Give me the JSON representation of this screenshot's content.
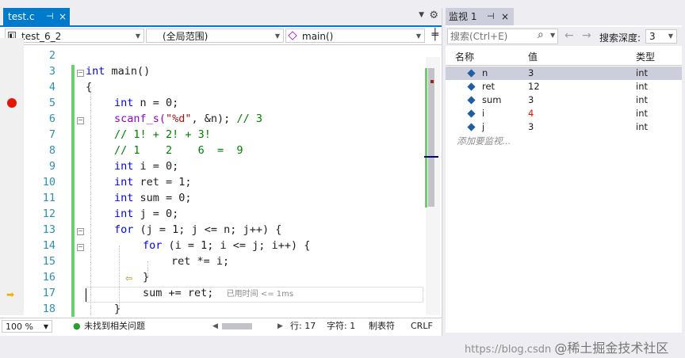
{
  "editor": {
    "tab_title": "test.c",
    "tab_pin": "⊣",
    "tab_close": "×",
    "tab_menu": "▼",
    "settings": "⚙",
    "nav": {
      "project": "test_6_2",
      "scope": "(全局范围)",
      "member": "main()"
    },
    "lines": [
      {
        "n": "2"
      },
      {
        "n": "3"
      },
      {
        "n": "4"
      },
      {
        "n": "5"
      },
      {
        "n": "6"
      },
      {
        "n": "7"
      },
      {
        "n": "8"
      },
      {
        "n": "9"
      },
      {
        "n": "10"
      },
      {
        "n": "11"
      },
      {
        "n": "12"
      },
      {
        "n": "13"
      },
      {
        "n": "14"
      },
      {
        "n": "15"
      },
      {
        "n": "16"
      },
      {
        "n": "17"
      },
      {
        "n": "18"
      }
    ],
    "code": {
      "l3_kw": "int",
      "l3_rest": " main()",
      "l4": "{",
      "l5_kw": "int",
      "l5_rest": " n = 0;",
      "l6_fn": "scanf_s(",
      "l6_str": "\"%d\"",
      "l6_rest": ", &n); ",
      "l6_cm": "// 3",
      "l7_cm": "// 1! + 2! + 3!",
      "l8_cm": "// 1    2    6  =  9",
      "l9_kw": "int",
      "l9_rest": " i = 0;",
      "l10_kw": "int",
      "l10_rest": " ret = 1;",
      "l11_kw": "int",
      "l11_rest": " sum = 0;",
      "l12_kw": "int",
      "l12_rest": " j = 0;",
      "l13_kw": "for",
      "l13_rest": " (j = 1; j <= n; j++) {",
      "l14_kw": "for",
      "l14_rest": " (i = 1; i <= j; i++) {",
      "l15": "ret *= i;",
      "l16": "}",
      "l17": "sum += ret;",
      "l17_elapsed": "已用时间 <= 1ms",
      "l18": "}"
    },
    "status": {
      "zoom": "100 %",
      "issues": "未找到相关问题",
      "line": "行: 17",
      "col": "字符: 1",
      "tabs": "制表符",
      "eol": "CRLF"
    }
  },
  "watch": {
    "tab_title": "监视 1",
    "tab_pin": "⊣",
    "tab_close": "×",
    "search_placeholder": "搜索(Ctrl+E)",
    "search_icon": "⌕",
    "back": "←",
    "forward": "→",
    "depth_label": "搜索深度:",
    "depth_value": "3",
    "columns": {
      "name": "名称",
      "value": "值",
      "type": "类型"
    },
    "rows": [
      {
        "name": "n",
        "value": "3",
        "type": "int",
        "changed": false
      },
      {
        "name": "ret",
        "value": "12",
        "type": "int",
        "changed": false
      },
      {
        "name": "sum",
        "value": "3",
        "type": "int",
        "changed": false
      },
      {
        "name": "i",
        "value": "4",
        "type": "int",
        "changed": true
      },
      {
        "name": "j",
        "value": "3",
        "type": "int",
        "changed": false
      }
    ],
    "add_hint": "添加要监视...",
    "changed_color": "#e51400"
  },
  "watermark": {
    "url": "https://blog.csdn",
    "brand": "@稀土掘金技术社区"
  }
}
